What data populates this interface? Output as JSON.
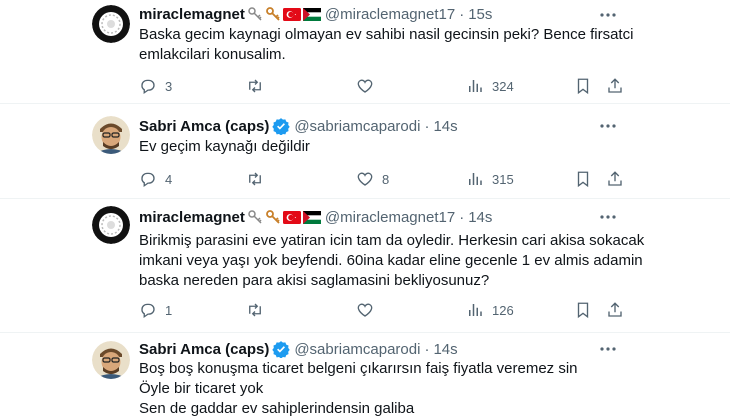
{
  "tweets": [
    {
      "display_name": "miraclemagnet",
      "handle": "@miraclemagnet17",
      "separator": "·",
      "time": "15s",
      "verified": false,
      "lines": [
        "Baska gecim kaynagi olmayan ev sahibi nasil gecinsin peki? Bence firsatci",
        "emlakcilari konusalim."
      ],
      "replies": "3",
      "retweets": "",
      "likes": "",
      "views": "324"
    },
    {
      "display_name": "Sabri Amca (caps)",
      "handle": "@sabriamcaparodi",
      "separator": "·",
      "time": "14s",
      "verified": true,
      "lines": [
        "Ev geçim kaynağı değildir"
      ],
      "replies": "4",
      "retweets": "",
      "likes": "8",
      "views": "315"
    },
    {
      "display_name": "miraclemagnet",
      "handle": "@miraclemagnet17",
      "separator": "·",
      "time": "14s",
      "verified": false,
      "lines": [
        "Birikmiş parasini eve yatiran icin tam da oyledir. Herkesin cari akisa sokacak",
        "imkani veya yaşı yok beyfendi. 60ina kadar eline gecenle 1 ev almis adamin",
        "baska nereden para akisi saglamasini bekliyosunuz?"
      ],
      "replies": "1",
      "retweets": "",
      "likes": "",
      "views": "126"
    },
    {
      "display_name": "Sabri Amca (caps)",
      "handle": "@sabriamcaparodi",
      "separator": "·",
      "time": "14s",
      "verified": true,
      "lines": [
        "Boş boş konuşma ticaret belgeni  çıkarırsın faiş fiyatla veremez sin",
        "Öyle bir ticaret yok",
        "Sen de gaddar ev sahiplerindensin galiba"
      ]
    }
  ],
  "colors": {
    "text": "#0f1419",
    "secondary": "#536471",
    "verified": "#1d9bf0",
    "divider": "#eff3f4"
  },
  "icons": {
    "reply": "reply-icon",
    "retweet": "retweet-icon",
    "like": "heart-icon",
    "views": "views-icon",
    "bookmark": "bookmark-icon",
    "share": "share-icon",
    "more": "more-icon",
    "verified": "verified-badge-icon",
    "name_emojis": [
      "key-icon",
      "key-icon",
      "turkey-flag-icon",
      "palestine-flag-icon"
    ]
  }
}
